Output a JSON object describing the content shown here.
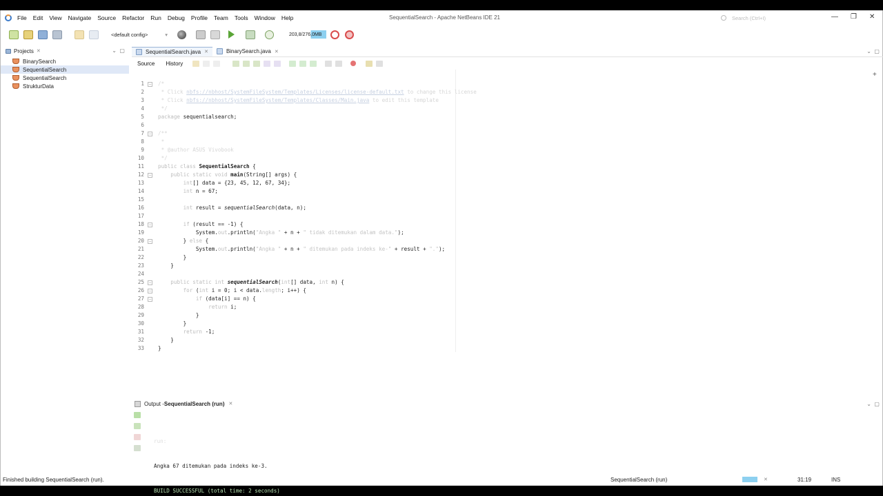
{
  "window": {
    "title": "SequentialSearch - Apache NetBeans IDE 21",
    "search_placeholder": "Search (Ctrl+I)",
    "minimize": "—",
    "restore": "❐",
    "close": "✕"
  },
  "menu": [
    "File",
    "Edit",
    "View",
    "Navigate",
    "Source",
    "Refactor",
    "Run",
    "Debug",
    "Profile",
    "Team",
    "Tools",
    "Window",
    "Help"
  ],
  "toolbar": {
    "config": "<default config>",
    "memory": "203,8/276,0MB"
  },
  "projects": {
    "tab_label": "Projects",
    "items": [
      "BinarySearch",
      "SequentialSearch",
      "SequentialSearch",
      "StrukturData"
    ],
    "selected_index": 1
  },
  "editor": {
    "tabs": [
      "SequentialSearch.java",
      "BinarySearch.java"
    ],
    "source_label": "Source",
    "history_label": "History",
    "lines": [
      {
        "n": "1",
        "html": "<span class='cm'>/*</span>",
        "fold": true
      },
      {
        "n": "2",
        "html": "<span class='cm'> * Click </span><span class='lk'>nbfs://nbhost/SystemFileSystem/Templates/Licenses/license-default.txt</span><span class='cm'> to change this license</span>"
      },
      {
        "n": "3",
        "html": "<span class='cm'> * Click </span><span class='lk'>nbfs://nbhost/SystemFileSystem/Templates/Classes/Main.java</span><span class='cm'> to edit this template</span>"
      },
      {
        "n": "4",
        "html": "<span class='cm'> */</span>"
      },
      {
        "n": "5",
        "html": "<span class='kw'>package</span> sequentialsearch;"
      },
      {
        "n": "6",
        "html": ""
      },
      {
        "n": "7",
        "html": "<span class='cm'>/**</span>",
        "fold": true
      },
      {
        "n": "8",
        "html": "<span class='cm'> *</span>"
      },
      {
        "n": "9",
        "html": "<span class='cm'> * @author ASUS Vivobook</span>"
      },
      {
        "n": "10",
        "html": "<span class='cm'> */</span>"
      },
      {
        "n": "11",
        "html": "<span class='kw'>public class</span> <span class='bold'>SequentialSearch</span> {"
      },
      {
        "n": "12",
        "html": "    <span class='kw'>public static void</span> <span class='bold'>main</span>(String[] args) {",
        "fold": true
      },
      {
        "n": "13",
        "html": "        <span class='kw'>int</span>[] data = {23, 45, 12, 67, 34};"
      },
      {
        "n": "14",
        "html": "        <span class='kw'>int</span> n = 67;"
      },
      {
        "n": "15",
        "html": ""
      },
      {
        "n": "16",
        "html": "        <span class='kw'>int</span> result = <span class='it'>sequentialSearch</span>(data, n);"
      },
      {
        "n": "17",
        "html": ""
      },
      {
        "n": "18",
        "html": "        <span class='kw'>if</span> (result == -1) {",
        "fold": true
      },
      {
        "n": "19",
        "html": "            System.<span class='kw'>out</span>.println(<span class='str'>\"Angka \"</span> + n + <span class='str'>\" tidak ditemukan dalam data.\"</span>);"
      },
      {
        "n": "20",
        "html": "        } <span class='kw'>else</span> {",
        "fold": true
      },
      {
        "n": "21",
        "html": "            System.<span class='kw'>out</span>.println(<span class='str'>\"Angka \"</span> + n + <span class='str'>\" ditemukan pada indeks ke-\"</span> + result + <span class='str'>\".\"</span>);"
      },
      {
        "n": "22",
        "html": "        }"
      },
      {
        "n": "23",
        "html": "    }"
      },
      {
        "n": "24",
        "html": ""
      },
      {
        "n": "25",
        "html": "    <span class='kw'>public static int</span> <span class='bold it'>sequentialSearch</span>(<span class='kw'>int</span>[] data, <span class='kw'>int</span> n) {",
        "fold": true
      },
      {
        "n": "26",
        "html": "        <span class='kw'>for</span> (<span class='kw'>int</span> i = 0; i &lt; data.<span class='kw'>length</span>; i++) {",
        "fold": true
      },
      {
        "n": "27",
        "html": "            <span class='kw'>if</span> (data[i] == n) {",
        "fold": true
      },
      {
        "n": "28",
        "html": "                <span class='kw'>return</span> i;"
      },
      {
        "n": "29",
        "html": "            }"
      },
      {
        "n": "30",
        "html": "        }"
      },
      {
        "n": "31",
        "html": "        <span class='kw'>return</span> -1;"
      },
      {
        "n": "32",
        "html": "    }"
      },
      {
        "n": "33",
        "html": "}"
      }
    ]
  },
  "output": {
    "tab_prefix": "Output - ",
    "tab_name": "SequentialSearch (run)",
    "lines": [
      "run:",
      "Angka 67 ditemukan pada indeks ke-3.",
      "BUILD SUCCESSFUL (total time: 2 seconds)"
    ]
  },
  "status": {
    "message": "Finished building SequentialSearch (run).",
    "process": "SequentialSearch (run)",
    "cancel": "✕",
    "position": "31:19",
    "mode": "INS"
  },
  "colors": {
    "accent": "#8dd0f0",
    "run_green": "#5aa537",
    "selection": "#dfe8f7"
  }
}
